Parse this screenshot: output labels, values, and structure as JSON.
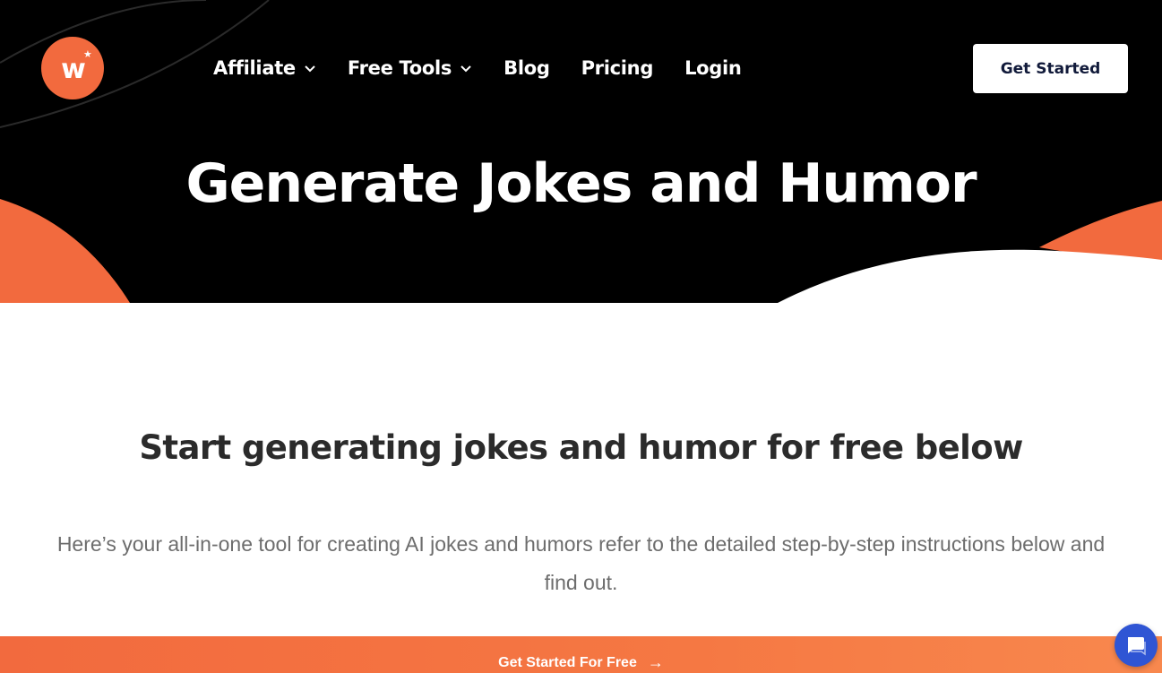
{
  "brand": {
    "logo_letter": "w",
    "logo_star": "★",
    "accent_color": "#f26a3e"
  },
  "nav": {
    "items": [
      {
        "label": "Affiliate",
        "has_dropdown": true
      },
      {
        "label": "Free Tools",
        "has_dropdown": true
      },
      {
        "label": "Blog",
        "has_dropdown": false
      },
      {
        "label": "Pricing",
        "has_dropdown": false
      },
      {
        "label": "Login",
        "has_dropdown": false
      }
    ],
    "cta_label": "Get Started"
  },
  "hero": {
    "title": "Generate Jokes and Humor"
  },
  "content": {
    "title": "Start generating jokes and humor for free below",
    "description": "Here’s your all-in-one tool for creating AI jokes and humors refer to the detailed step-by-step instructions below and find out."
  },
  "bottom_bar": {
    "label": "Get Started For Free",
    "arrow": "→"
  },
  "chat": {
    "icon": "chat-icon",
    "color": "#2f55d4"
  }
}
